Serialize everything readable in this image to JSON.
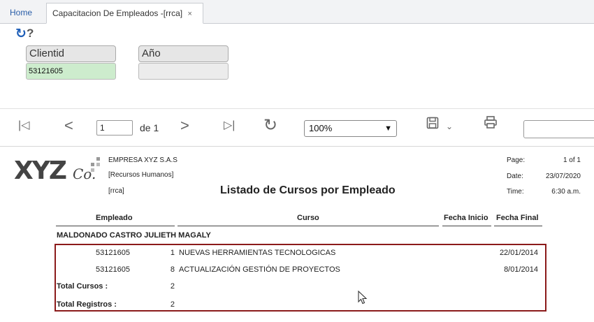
{
  "tabs": {
    "home": "Home",
    "active": "Capacitacion De Empleados -[rrca]",
    "close": "×"
  },
  "filters": {
    "cliente_label": "Clientid",
    "cliente_value": "53121605",
    "anio_label": "Año",
    "anio_value": ""
  },
  "toolbar": {
    "page_current": "1",
    "page_of": "de 1",
    "zoom": "100%",
    "icons": [
      "first-page-icon",
      "prev-page-icon",
      "next-page-icon",
      "last-page-icon",
      "reload-icon",
      "save-icon",
      "print-icon"
    ]
  },
  "report": {
    "logo": "XYZ Co.",
    "company_name": "EMPRESA XYZ S.A.S",
    "department": "[Recursos Humanos]",
    "code": "[rrca]",
    "title": "Listado de Cursos por Empleado",
    "page_label": "Page:",
    "page_value": "1 of 1",
    "date_label": "Date:",
    "date_value": "23/07/2020",
    "time_label": "Time:",
    "time_value": "6:30 a.m.",
    "columns": {
      "empleado": "Empleado",
      "curso": "Curso",
      "fecha_inicio": "Fecha Inicio",
      "fecha_final": "Fecha Final"
    },
    "employee_name": "MALDONADO CASTRO JULIETH MAGALY",
    "rows": [
      {
        "id": "53121605",
        "num": "1",
        "curso": "NUEVAS HERRAMIENTAS TECNOLOGICAS",
        "fecha_inicio": "",
        "fecha_final": "22/01/2014"
      },
      {
        "id": "53121605",
        "num": "8",
        "curso": "ACTUALIZACIÓN GESTIÓN DE PROYECTOS",
        "fecha_inicio": "",
        "fecha_final": "8/01/2014"
      }
    ],
    "total_cursos_label": "Total Cursos :",
    "total_cursos_value": "2",
    "total_registros_label": "Total Registros :",
    "total_registros_value": "2"
  },
  "colors": {
    "tab_link": "#2a5ea8",
    "input_highlight": "#cdeccd",
    "detail_border": "#8b1a1a"
  }
}
